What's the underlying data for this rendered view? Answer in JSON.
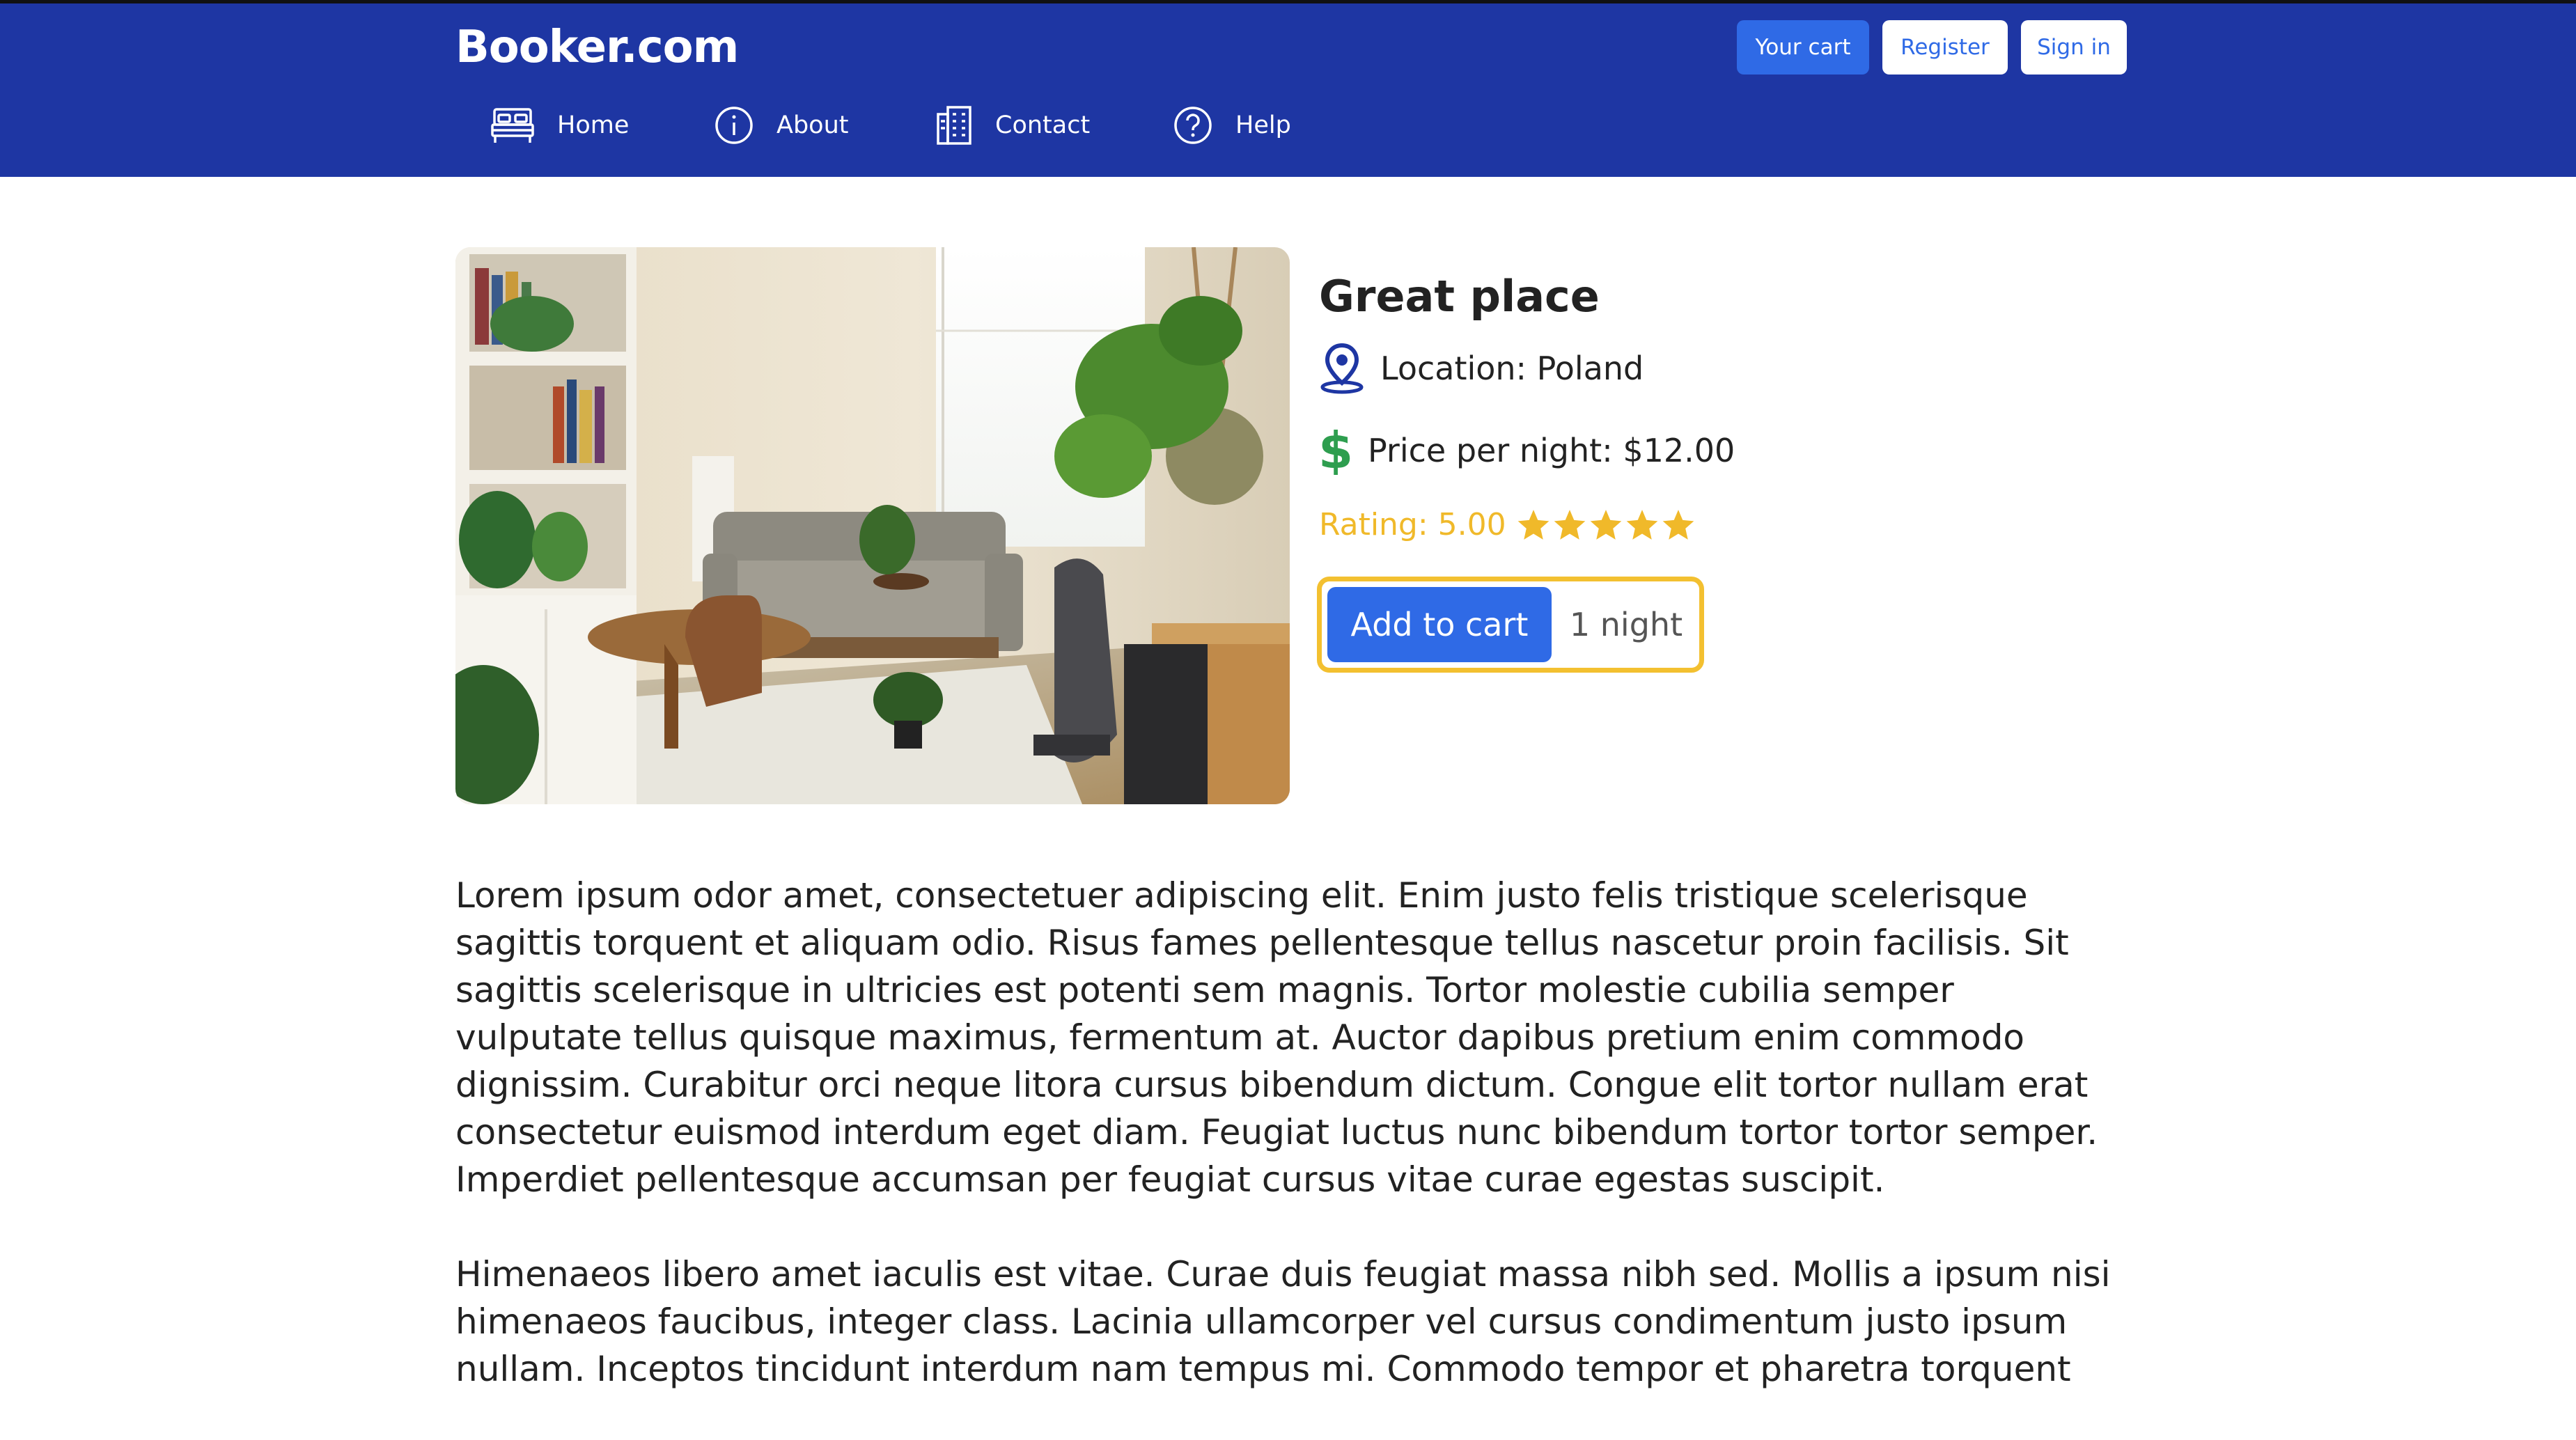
{
  "header": {
    "brand": "Booker.com",
    "buttons": {
      "cart": "Your cart",
      "register": "Register",
      "sign_in": "Sign in"
    },
    "nav": [
      {
        "label": "Home",
        "icon": "bed-icon"
      },
      {
        "label": "About",
        "icon": "info-icon"
      },
      {
        "label": "Contact",
        "icon": "building-icon"
      },
      {
        "label": "Help",
        "icon": "question-icon"
      }
    ],
    "colors": {
      "bar": "#1e36a3",
      "primary_button": "#2f6ae6"
    }
  },
  "listing": {
    "photo": "living-room-photo",
    "title": "Great place",
    "location": "Location: Poland",
    "price": "Price per night: $12.00",
    "rating_label": "Rating: 5.00",
    "rating_value": 5,
    "rating_max": 5,
    "add_to_cart": "Add to cart",
    "nights": "1 night",
    "colors": {
      "location_icon": "#1e36a3",
      "price_icon": "#2e9e4f",
      "rating": "#f0b92a",
      "cart_border": "#f3c030"
    }
  },
  "description": [
    "Lorem ipsum odor amet, consectetuer adipiscing elit. Enim justo felis tristique scelerisque sagittis torquent et aliquam odio. Risus fames pellentesque tellus nascetur proin facilisis. Sit sagittis scelerisque in ultricies est potenti sem magnis. Tortor molestie cubilia semper vulputate tellus quisque maximus, fermentum at. Auctor dapibus pretium enim commodo dignissim. Curabitur orci neque litora cursus bibendum dictum. Congue elit tortor nullam erat consectetur euismod interdum eget diam. Feugiat luctus nunc bibendum tortor tortor semper. Imperdiet pellentesque accumsan per feugiat cursus vitae curae egestas suscipit.",
    "Himenaeos libero amet iaculis est vitae. Curae duis feugiat massa nibh sed. Mollis a ipsum nisi himenaeos faucibus, integer class. Lacinia ullamcorper vel cursus condimentum justo ipsum nullam. Inceptos tincidunt interdum nam tempus mi. Commodo tempor et pharetra torquent"
  ]
}
